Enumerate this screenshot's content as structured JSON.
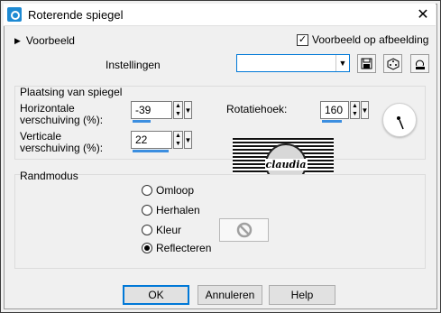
{
  "window": {
    "title": "Roterende spiegel",
    "close_glyph": "✕"
  },
  "preview": {
    "toggle_label": "Voorbeeld",
    "checkbox_label": "Voorbeeld op afbeelding",
    "checked": true
  },
  "settings": {
    "label": "Instellingen",
    "value": ""
  },
  "placement": {
    "group_label": "Plaatsing van spiegel",
    "horizontal_label_line1": "Horizontale",
    "horizontal_label_line2": "verschuiving (%):",
    "horizontal_value": "-39",
    "vertical_label_line1": "Verticale",
    "vertical_label_line2": "verschuiving (%):",
    "vertical_value": "22",
    "rotation_label": "Rotatiehoek:",
    "rotation_value": "160"
  },
  "edge_mode": {
    "group_label": "Randmodus",
    "options": [
      "Omloop",
      "Herhalen",
      "Kleur",
      "Reflecteren"
    ],
    "selected": "Reflecteren"
  },
  "preview_image": {
    "watermark_text": "claudia"
  },
  "buttons": {
    "ok": "OK",
    "cancel": "Annuleren",
    "help": "Help"
  }
}
